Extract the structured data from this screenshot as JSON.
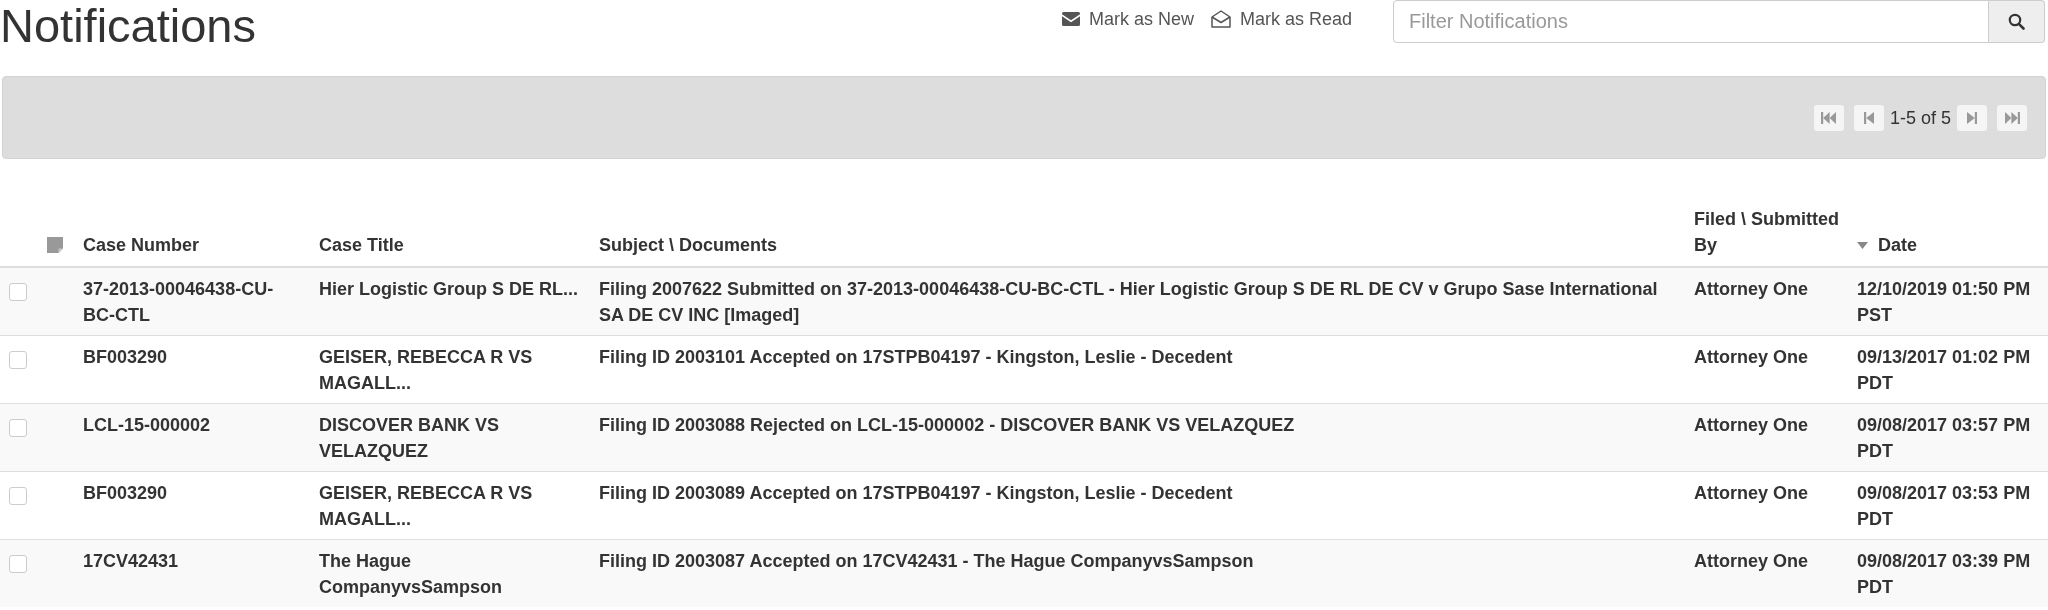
{
  "page": {
    "title": "Notifications"
  },
  "toolbar": {
    "actions": [
      {
        "kind": "new",
        "label": "Mark as New"
      },
      {
        "kind": "read",
        "label": "Mark as Read"
      }
    ],
    "filter": {
      "placeholder": "Filter Notifications"
    }
  },
  "pager": {
    "range": "1-5 of 5"
  },
  "table": {
    "columns": [
      {
        "label": "Case Number",
        "sorted": false
      },
      {
        "label": "Case Title",
        "sorted": false
      },
      {
        "label": "Subject \\ Documents",
        "sorted": false
      },
      {
        "label": "Filed \\ Submitted By",
        "sorted": false
      },
      {
        "label": "Date",
        "sorted": true
      }
    ],
    "rows": [
      {
        "checked": false,
        "cells": [
          "37-2013-00046438-CU-BC-CTL",
          "Hier Logistic Group S DE RL...",
          "Filing 2007622 Submitted on 37-2013-00046438-CU-BC-CTL - Hier Logistic Group S DE RL DE CV v Grupo Sase International SA DE CV INC [Imaged]",
          "Attorney One",
          "12/10/2019 01:50 PM PST"
        ]
      },
      {
        "checked": false,
        "cells": [
          "BF003290",
          "GEISER, REBECCA R VS MAGALL...",
          "Filing ID 2003101 Accepted on 17STPB04197 - Kingston, Leslie - Decedent",
          "Attorney One",
          "09/13/2017 01:02 PM PDT"
        ]
      },
      {
        "checked": false,
        "cells": [
          "LCL-15-000002",
          "DISCOVER BANK VS VELAZQUEZ",
          "Filing ID 2003088 Rejected on LCL-15-000002 - DISCOVER BANK VS VELAZQUEZ",
          "Attorney One",
          "09/08/2017 03:57 PM PDT"
        ]
      },
      {
        "checked": false,
        "cells": [
          "BF003290",
          "GEISER, REBECCA R VS MAGALL...",
          "Filing ID 2003089 Accepted on 17STPB04197 - Kingston, Leslie - Decedent",
          "Attorney One",
          "09/08/2017 03:53 PM PDT"
        ]
      },
      {
        "checked": false,
        "cells": [
          "17CV42431",
          "The Hague CompanyvsSampson",
          "Filing ID 2003087 Accepted on 17CV42431 - The Hague CompanyvsSampson",
          "Attorney One",
          "09/08/2017 03:39 PM PDT"
        ]
      }
    ]
  }
}
